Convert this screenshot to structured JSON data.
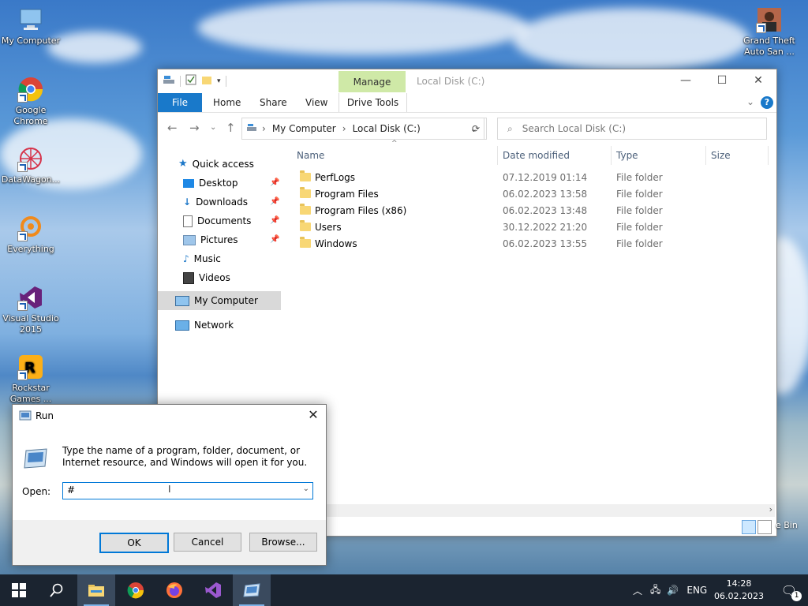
{
  "desktop": {
    "icons": [
      {
        "label": "My Computer"
      },
      {
        "label": "Google Chrome"
      },
      {
        "label": "DataWagon..."
      },
      {
        "label": "Everything"
      },
      {
        "label": "Visual Studio 2015"
      },
      {
        "label": "Rockstar Games ..."
      },
      {
        "label": "Grand Theft Auto San ..."
      }
    ],
    "recycle_partial": "e Bin"
  },
  "explorer": {
    "title": "Local Disk (C:)",
    "manage_tab": "Manage",
    "ribbon_tabs": [
      "File",
      "Home",
      "Share",
      "View",
      "Drive Tools"
    ],
    "address": {
      "crumbs": [
        "My Computer",
        "Local Disk (C:)"
      ]
    },
    "search_placeholder": "Search Local Disk (C:)",
    "nav": {
      "quick_access": "Quick access",
      "items": [
        "Desktop",
        "Downloads",
        "Documents",
        "Pictures",
        "Music",
        "Videos"
      ],
      "my_computer": "My Computer",
      "network": "Network"
    },
    "columns": [
      "Name",
      "Date modified",
      "Type",
      "Size"
    ],
    "files": [
      {
        "name": "PerfLogs",
        "date": "07.12.2019 01:14",
        "type": "File folder"
      },
      {
        "name": "Program Files",
        "date": "06.02.2023 13:58",
        "type": "File folder"
      },
      {
        "name": "Program Files (x86)",
        "date": "06.02.2023 13:48",
        "type": "File folder"
      },
      {
        "name": "Users",
        "date": "30.12.2022 21:20",
        "type": "File folder"
      },
      {
        "name": "Windows",
        "date": "06.02.2023 13:55",
        "type": "File folder"
      }
    ]
  },
  "run_dialog": {
    "title": "Run",
    "description": "Type the name of a program, folder, document, or Internet resource, and Windows will open it for you.",
    "open_label": "Open:",
    "open_value": "#",
    "ok": "OK",
    "cancel": "Cancel",
    "browse": "Browse..."
  },
  "taskbar": {
    "language": "ENG",
    "time": "14:28",
    "date": "06.02.2023",
    "notifications": "1"
  },
  "colors": {
    "accent": "#0078d7",
    "file_tab": "#1979ca",
    "manage_tab": "#cfe9a7",
    "taskbar": "#1b2430"
  }
}
